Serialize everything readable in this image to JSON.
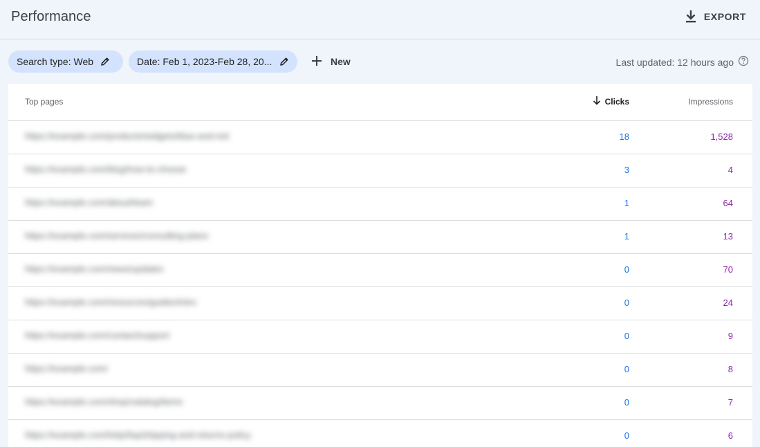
{
  "header": {
    "title": "Performance",
    "export_label": "EXPORT"
  },
  "filters": {
    "search_type": "Search type: Web",
    "date": "Date: Feb 1, 2023-Feb 28, 20...",
    "new_label": "New",
    "last_updated": "Last updated: 12 hours ago"
  },
  "table": {
    "col_pages": "Top pages",
    "col_clicks": "Clicks",
    "col_impressions": "Impressions",
    "rows": [
      {
        "url": "https://example.com/products/widgets/blue-and-red",
        "clicks": "18",
        "impressions": "1,528"
      },
      {
        "url": "https://example.com/blog/how-to-choose",
        "clicks": "3",
        "impressions": "4"
      },
      {
        "url": "https://example.com/about/team",
        "clicks": "1",
        "impressions": "64"
      },
      {
        "url": "https://example.com/services/consulting-plans",
        "clicks": "1",
        "impressions": "13"
      },
      {
        "url": "https://example.com/news/updates",
        "clicks": "0",
        "impressions": "70"
      },
      {
        "url": "https://example.com/resources/guides/intro",
        "clicks": "0",
        "impressions": "24"
      },
      {
        "url": "https://example.com/contact/support",
        "clicks": "0",
        "impressions": "9"
      },
      {
        "url": "https://example.com/",
        "clicks": "0",
        "impressions": "8"
      },
      {
        "url": "https://example.com/shop/catalog/items",
        "clicks": "0",
        "impressions": "7"
      },
      {
        "url": "https://example.com/help/faq/shipping-and-returns-policy",
        "clicks": "0",
        "impressions": "6"
      }
    ]
  },
  "colors": {
    "clicks": "#1a73e8",
    "impressions": "#8e24aa",
    "chip_bg": "#d3e3fd",
    "page_bg": "#f0f4fb"
  },
  "icons": {
    "export": "download-icon",
    "edit": "pencil-icon",
    "add": "plus-icon",
    "help": "help-circle-icon",
    "sort": "arrow-down-icon"
  }
}
